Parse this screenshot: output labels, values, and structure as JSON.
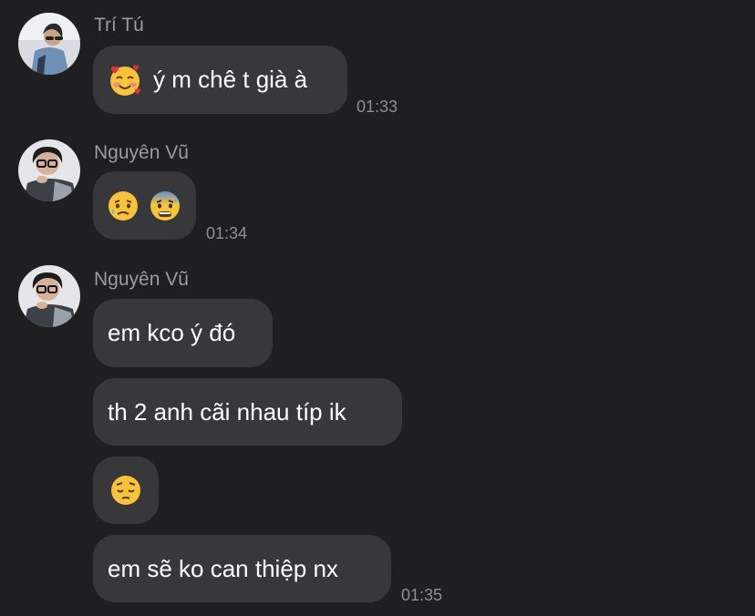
{
  "messages": [
    {
      "sender": "Trí Tú",
      "avatar": "avatar-tri-tu",
      "bubbles": [
        {
          "emoji": "smiling-face-with-hearts-icon",
          "text": "ý m chê t già à",
          "time": "01:33"
        }
      ]
    },
    {
      "sender": "Nguyên Vũ",
      "avatar": "avatar-nguyen-vu",
      "bubbles": [
        {
          "emojis": [
            "sad-but-relieved-face-icon",
            "anxious-face-with-sweat-icon"
          ],
          "time": "01:34"
        }
      ]
    },
    {
      "sender": "Nguyên Vũ",
      "avatar": "avatar-nguyen-vu",
      "bubbles": [
        {
          "text": "em kco ý đó"
        },
        {
          "text": "th 2 anh cãi nhau típ ik"
        },
        {
          "emoji": "pensive-face-icon"
        },
        {
          "text": "em sẽ ko can thiệp nx",
          "time": "01:35"
        }
      ]
    }
  ],
  "colors": {
    "background": "#1f1f21",
    "bubble": "#38383b",
    "sender_name": "#9b9ba0",
    "timestamp": "#8e8e93",
    "message_text": "#ffffff"
  }
}
